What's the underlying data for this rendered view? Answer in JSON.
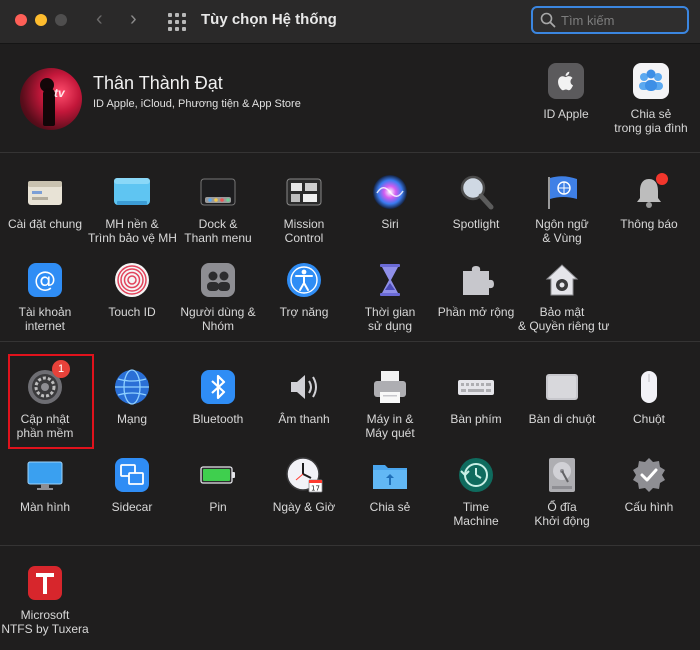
{
  "window": {
    "title": "Tùy chọn Hệ thống",
    "search_placeholder": "Tìm kiếm"
  },
  "account": {
    "name": "Thân Thành Đạt",
    "subtitle": "ID Apple, iCloud, Phương tiện & App Store",
    "avatar_text": "tv",
    "apple_id_label": "ID Apple",
    "family_label_1": "Chia sẻ",
    "family_label_2": "trong gia đình"
  },
  "row1": [
    {
      "l1": "Cài đặt chung",
      "l2": ""
    },
    {
      "l1": "MH nền &",
      "l2": "Trình bảo vệ MH"
    },
    {
      "l1": "Dock &",
      "l2": "Thanh menu"
    },
    {
      "l1": "Mission",
      "l2": "Control"
    },
    {
      "l1": "Siri",
      "l2": ""
    },
    {
      "l1": "Spotlight",
      "l2": ""
    },
    {
      "l1": "Ngôn ngữ",
      "l2": "& Vùng"
    },
    {
      "l1": "Thông báo",
      "l2": ""
    }
  ],
  "row2": [
    {
      "l1": "Tài khoản",
      "l2": "internet"
    },
    {
      "l1": "Touch ID",
      "l2": ""
    },
    {
      "l1": "Người dùng &",
      "l2": "Nhóm"
    },
    {
      "l1": "Trợ năng",
      "l2": ""
    },
    {
      "l1": "Thời gian",
      "l2": "sử dụng"
    },
    {
      "l1": "Phần mở rộng",
      "l2": ""
    },
    {
      "l1": "Bảo mật",
      "l2": "& Quyền riêng tư"
    }
  ],
  "row3": [
    {
      "l1": "Cập nhật",
      "l2": "phần mềm"
    },
    {
      "l1": "Mạng",
      "l2": ""
    },
    {
      "l1": "Bluetooth",
      "l2": ""
    },
    {
      "l1": "Âm thanh",
      "l2": ""
    },
    {
      "l1": "Máy in &",
      "l2": "Máy quét"
    },
    {
      "l1": "Bàn phím",
      "l2": ""
    },
    {
      "l1": "Bàn di chuột",
      "l2": ""
    },
    {
      "l1": "Chuột",
      "l2": ""
    }
  ],
  "row4": [
    {
      "l1": "Màn hình",
      "l2": ""
    },
    {
      "l1": "Sidecar",
      "l2": ""
    },
    {
      "l1": "Pin",
      "l2": ""
    },
    {
      "l1": "Ngày & Giờ",
      "l2": ""
    },
    {
      "l1": "Chia sẻ",
      "l2": ""
    },
    {
      "l1": "Time",
      "l2": "Machine"
    },
    {
      "l1": "Ổ đĩa",
      "l2": "Khởi động"
    },
    {
      "l1": "Cấu hình",
      "l2": ""
    }
  ],
  "row5": [
    {
      "l1": "Microsoft",
      "l2": "NTFS by Tuxera"
    }
  ],
  "badges": {
    "software_update": "1"
  },
  "colors": {
    "highlight": "#e0121c",
    "search_focus": "#3b86e0",
    "badge": "#e8423a"
  }
}
